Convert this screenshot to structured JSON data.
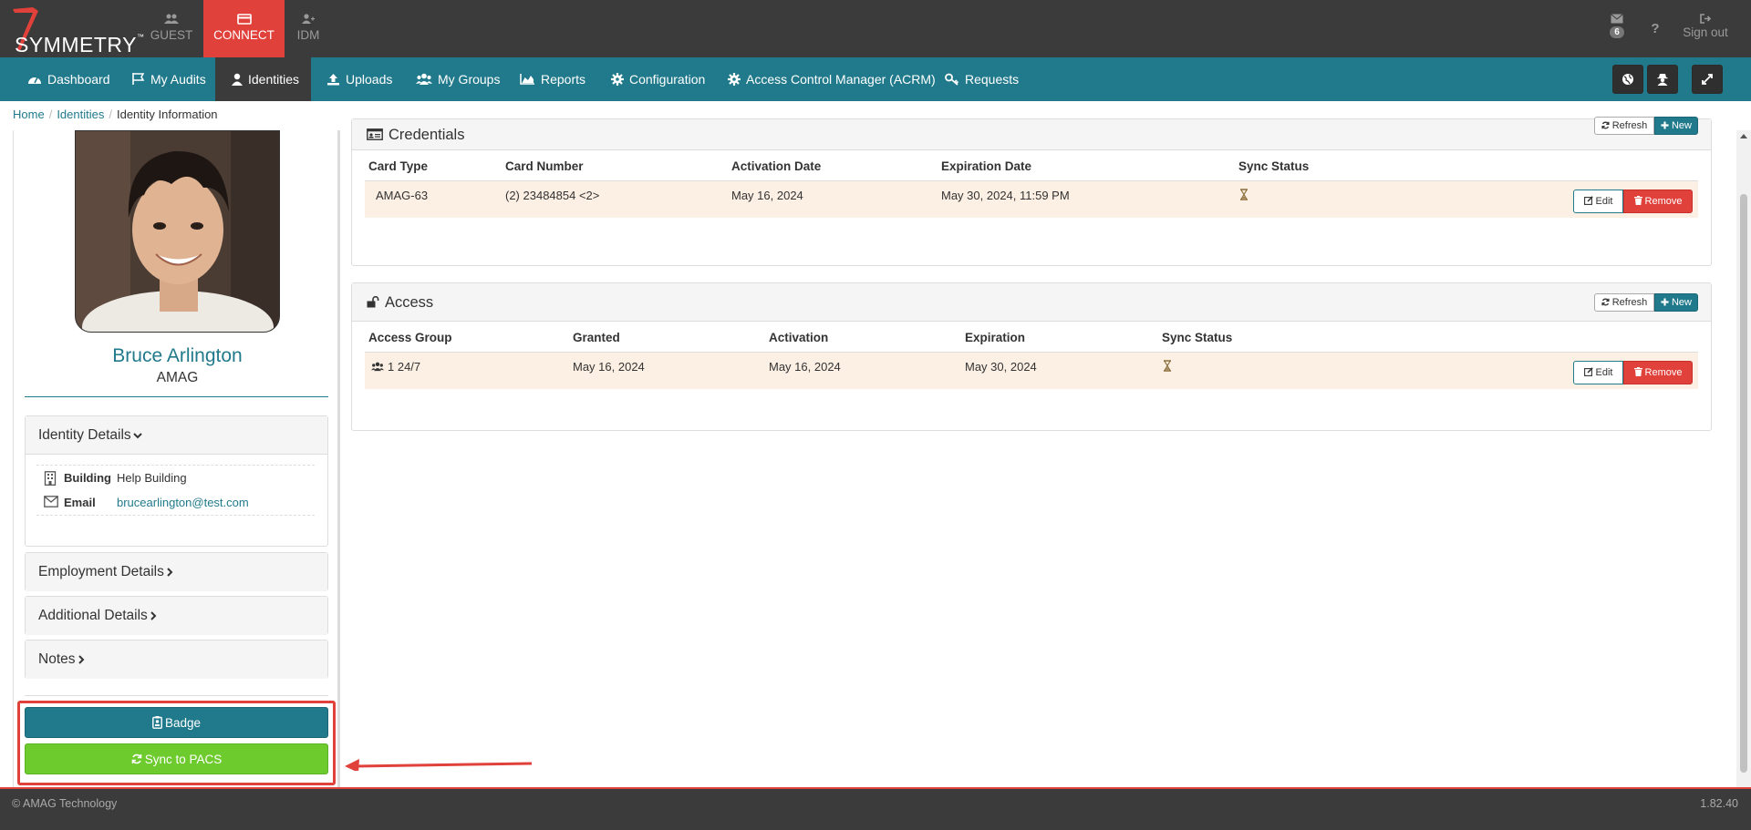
{
  "brand": {
    "logo_text": "SYMMETRY",
    "logo_mark": "™"
  },
  "app_tabs": [
    {
      "label": "GUEST",
      "icon": "users-icon",
      "active": false
    },
    {
      "label": "CONNECT",
      "icon": "card-icon",
      "active": true
    },
    {
      "label": "IDM",
      "icon": "user-plus-icon",
      "active": false
    }
  ],
  "top_right": {
    "mail_count": "6",
    "help_label": "?",
    "signout_label": "Sign out"
  },
  "nav": {
    "items": [
      {
        "label": "Dashboard",
        "icon": "dashboard-icon"
      },
      {
        "label": "My Audits",
        "icon": "flag-icon"
      },
      {
        "label": "Identities",
        "icon": "user-icon",
        "active": true
      },
      {
        "label": "Uploads",
        "icon": "upload-icon"
      },
      {
        "label": "My Groups",
        "icon": "group-icon"
      },
      {
        "label": "Reports",
        "icon": "area-chart-icon"
      },
      {
        "label": "Configuration",
        "icon": "gear-icon"
      },
      {
        "label": "Access Control Manager (ACRM)",
        "icon": "gear-icon"
      },
      {
        "label": "Requests",
        "icon": "key-icon"
      }
    ],
    "right_buttons": [
      "globe-icon",
      "user-secret-icon",
      "expand-icon"
    ]
  },
  "breadcrumb": {
    "home": "Home",
    "identities": "Identities",
    "current": "Identity Information",
    "sep": "/"
  },
  "profile": {
    "name": "Bruce Arlington",
    "org": "AMAG"
  },
  "identity_details": {
    "title": "Identity Details",
    "rows": [
      {
        "label": "Building",
        "value": "Help Building",
        "icon": "building-icon"
      },
      {
        "label": "Email",
        "value": "brucearlington@test.com",
        "icon": "envelope-icon"
      }
    ]
  },
  "sections": {
    "employment": "Employment Details",
    "additional": "Additional Details",
    "notes": "Notes"
  },
  "actions": {
    "badge": "Badge",
    "sync": "Sync to PACS"
  },
  "buttons": {
    "refresh": "Refresh",
    "new": "New",
    "edit": "Edit",
    "remove": "Remove"
  },
  "credentials": {
    "title": "Credentials",
    "columns": [
      "Card Type",
      "Card Number",
      "Activation Date",
      "Expiration Date",
      "Sync Status"
    ],
    "rows": [
      {
        "card_type": "AMAG-63",
        "card_number": "(2) 23484854 <2>",
        "activation": "May 16, 2024",
        "expiration": "May 30, 2024, 11:59 PM",
        "sync_icon": "hourglass-icon"
      }
    ]
  },
  "access": {
    "title": "Access",
    "columns": [
      "Access Group",
      "Granted",
      "Activation",
      "Expiration",
      "Sync Status"
    ],
    "rows": [
      {
        "group": "1 24/7",
        "granted": "May 16, 2024",
        "activation": "May 16, 2024",
        "expiration": "May 30, 2024",
        "sync_icon": "hourglass-icon"
      }
    ]
  },
  "footer": {
    "copyright": "© AMAG Technology",
    "version": "1.82.40"
  },
  "colors": {
    "teal": "#217a8c",
    "red": "#e0413b",
    "green": "#6ecb2e",
    "dark": "#3b3b3b",
    "row_highlight": "#fcefe3"
  }
}
